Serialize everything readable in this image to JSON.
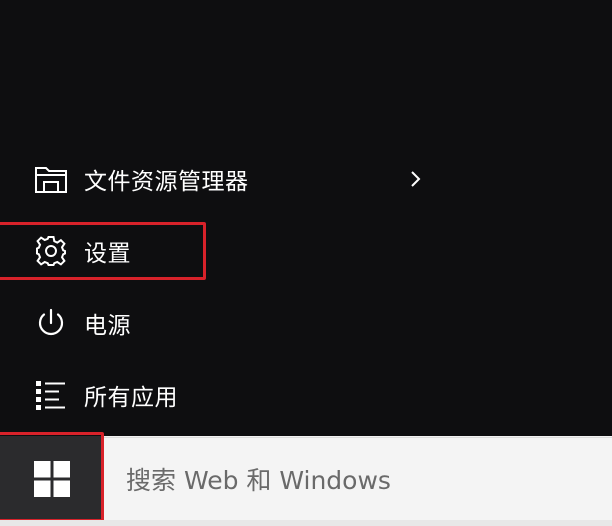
{
  "menu": {
    "items": [
      {
        "label": "文件资源管理器",
        "icon": "folder-icon",
        "has_submenu": true
      },
      {
        "label": "设置",
        "icon": "gear-icon",
        "has_submenu": false
      },
      {
        "label": "电源",
        "icon": "power-icon",
        "has_submenu": false
      },
      {
        "label": "所有应用",
        "icon": "list-icon",
        "has_submenu": false
      }
    ]
  },
  "taskbar": {
    "start_icon": "windows-logo-icon",
    "search": {
      "placeholder": "搜索 Web 和 Windows",
      "value": ""
    }
  },
  "colors": {
    "menu_background": "#0e0e10",
    "menu_text": "#ffffff",
    "highlight": "#d8222a",
    "start_button": "#2b2b2d",
    "search_background": "#f4f4f4",
    "search_text": "#6a6a6a"
  }
}
